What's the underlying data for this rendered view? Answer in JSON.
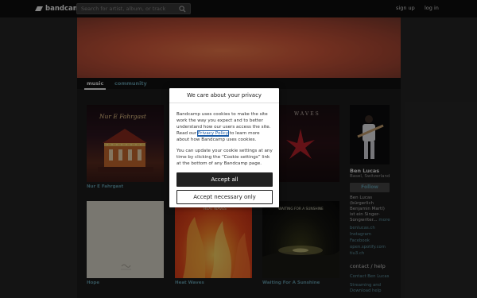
{
  "header": {
    "logo_text": "bandcamp",
    "search_placeholder": "Search for artist, album, or track",
    "signup_label": "sign up",
    "login_label": "log in"
  },
  "tabs": [
    {
      "label": "music",
      "active": true
    },
    {
      "label": "community",
      "active": false
    }
  ],
  "albums": [
    {
      "title": "Nur E Fahrgast",
      "cover_text": "Nur E Fahrgast"
    },
    {
      "title": "",
      "cover_text": "WAVES"
    },
    {
      "title": "Hope",
      "cover_text": ""
    },
    {
      "title": "Heat Waves",
      "cover_text": "HEAT WAVES"
    },
    {
      "title": "Waiting For A Sunshine",
      "cover_text": "WAITING FOR A SUNSHINE"
    }
  ],
  "artist": {
    "name": "Ben Lucas",
    "location": "Basel, Switzerland",
    "follow_label": "Follow",
    "bio": "Ben Lucas (bürgerlich Benjamin Martl) ist ein Singer-Songwriter...",
    "more_label": "more",
    "links": [
      "benlucas.ch",
      "Instagram",
      "Facebook",
      "open.spotify.com",
      "tiu3.ch"
    ],
    "contact_heading": "contact / help",
    "contact_links": [
      "Contact Ben Lucas",
      "Streaming and Download help"
    ]
  },
  "cookie_modal": {
    "title": "We care about your privacy",
    "para1_before": "Bandcamp uses cookies to make the site work the way you expect and to better understand how our users access the site. Read our ",
    "privacy_link": "Privacy Policy",
    "para1_after": " to learn more about how Bandcamp uses cookies.",
    "para2": "You can update your cookie settings at any time by clicking the “Cookie settings” link at the bottom of any Bandcamp page.",
    "accept_all": "Accept all",
    "accept_necessary": "Accept necessary only"
  },
  "colors": {
    "link": "#629aa9",
    "topbar": "#0d0d0d",
    "page_bg": "#1c1c1c"
  }
}
